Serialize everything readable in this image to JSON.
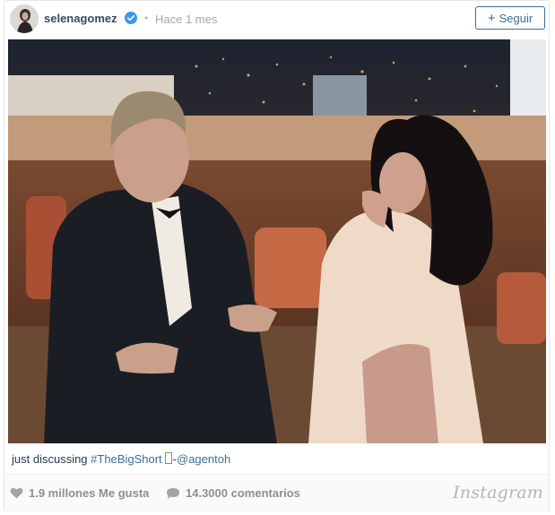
{
  "post": {
    "username": "selenagomez",
    "time_ago": "Hace 1 mes",
    "follow_label": "Seguir",
    "caption": {
      "text": "just discussing ",
      "hashtag": "#TheBigShort",
      "separator": "-",
      "mention": "@agentoh"
    },
    "likes": "1.9 millones Me gusta",
    "comments": "14.3000 comentarios",
    "brand": "Instagram"
  },
  "colors": {
    "link": "#3a6d99",
    "verified": "#3897f0",
    "muted": "#8c9093"
  }
}
